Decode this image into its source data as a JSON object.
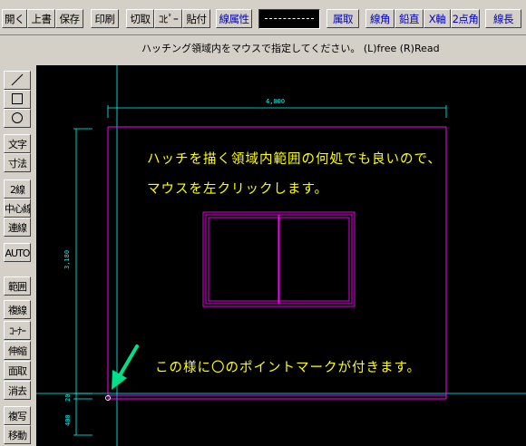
{
  "toolbar": {
    "open": "開く",
    "overwrite": "上書",
    "save": "保存",
    "print": "印刷",
    "cut": "切取",
    "copy": "ｺﾋﾟｰ",
    "paste": "貼付",
    "line_attr": "線属性",
    "layer_get": "属取",
    "line_angle": "線角",
    "vertical": "鉛直",
    "x_axis": "X軸",
    "two_point_angle": "2点角",
    "line_length": "線長"
  },
  "status_message": "ハッチング領域内をマウスで指定してください。 (L)free (R)Read",
  "sidebar": {
    "line_icon": "line-tool-icon",
    "rect_icon": "rectangle-tool-icon",
    "circle_icon": "circle-tool-icon",
    "text": "文字",
    "dimension": "寸法",
    "double_line": "2線",
    "center_line": "中心線",
    "continuous_line": "連線",
    "auto": "AUTO",
    "range": "範囲",
    "duplicate_line": "複線",
    "corner": "ｺｰﾅｰ",
    "stretch": "伸縮",
    "chamfer": "面取",
    "erase": "消去",
    "copy": "複写",
    "move": "移動"
  },
  "canvas": {
    "instruction_line1": "ハッチを描く領域内範囲の何処でも良いので、",
    "instruction_line2": "マウスを左クリックします。",
    "note": "この様に〇のポイントマークが付きます。",
    "dim_top": "4,000",
    "dim_left_main": "3,180",
    "dim_left_small": "20",
    "dim_left_bottom": "400",
    "colors": {
      "background": "#000000",
      "wall": "#ff00ff",
      "dimension": "#00ffff",
      "annotation": "#ffff00",
      "arrow": "#00e08a"
    }
  }
}
